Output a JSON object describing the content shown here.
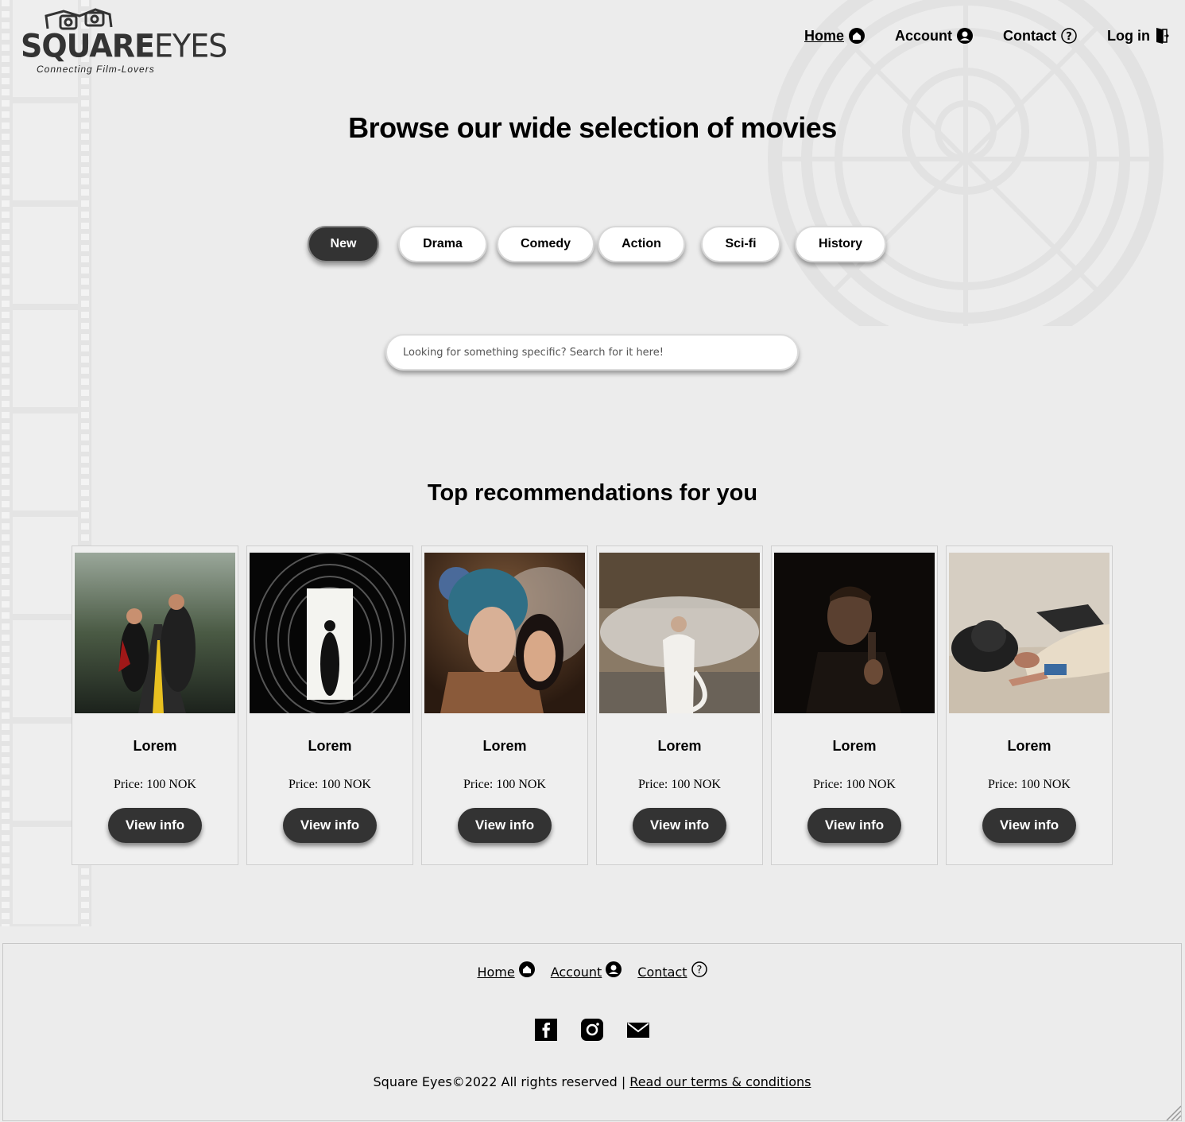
{
  "brand": {
    "name_bold": "SQUARE",
    "name_light": "EYES",
    "tagline": "Connecting Film-Lovers"
  },
  "nav": {
    "items": [
      {
        "label": "Home",
        "icon": "home-icon",
        "active": true
      },
      {
        "label": "Account",
        "icon": "account-icon",
        "active": false
      },
      {
        "label": "Contact",
        "icon": "help-icon",
        "active": false
      },
      {
        "label": "Log in",
        "icon": "login-door-icon",
        "active": false
      }
    ]
  },
  "main": {
    "title": "Browse our wide selection of movies",
    "genres": [
      {
        "label": "New",
        "active": true
      },
      {
        "label": "Drama",
        "active": false
      },
      {
        "label": "Comedy",
        "active": false
      },
      {
        "label": "Action",
        "active": false
      },
      {
        "label": "Sci-fi",
        "active": false
      },
      {
        "label": "History",
        "active": false
      }
    ],
    "search_placeholder": "Looking for something specific? Search for it here!",
    "recommend_title": "Top recommendations for you",
    "movies": [
      {
        "title": "Lorem",
        "price": "Price: 100 NOK",
        "button": "View info"
      },
      {
        "title": "Lorem",
        "price": "Price: 100 NOK",
        "button": "View info"
      },
      {
        "title": "Lorem",
        "price": "Price: 100 NOK",
        "button": "View info"
      },
      {
        "title": "Lorem",
        "price": "Price: 100 NOK",
        "button": "View info"
      },
      {
        "title": "Lorem",
        "price": "Price: 100 NOK",
        "button": "View info"
      },
      {
        "title": "Lorem",
        "price": "Price: 100 NOK",
        "button": "View info"
      }
    ]
  },
  "footer": {
    "nav": [
      {
        "label": "Home",
        "icon": "home-icon"
      },
      {
        "label": "Account",
        "icon": "account-icon"
      },
      {
        "label": "Contact",
        "icon": "help-icon"
      }
    ],
    "social": [
      "facebook-icon",
      "instagram-icon",
      "mail-icon"
    ],
    "copyright": "Square Eyes©2022 All rights reserved | ",
    "terms_link": "Read our terms & conditions"
  },
  "colors": {
    "background": "#ececec",
    "button_dark": "#333333",
    "button_light": "#ffffff"
  }
}
